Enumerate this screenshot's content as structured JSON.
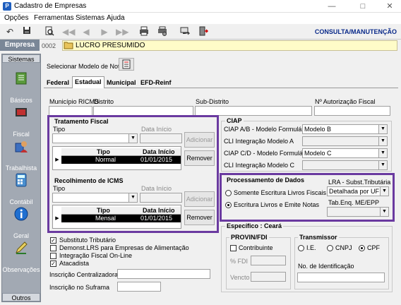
{
  "window": {
    "title": "Cadastro de Empresas",
    "app_icon": "P"
  },
  "menu": [
    "Opções",
    "Ferramentas",
    "Sistemas",
    "Ajuda"
  ],
  "toolbar": {
    "mode": "CONSULTA/MANUTENÇÃO"
  },
  "empresa": {
    "label": "Empresa",
    "code": "0002",
    "name": "LUCRO PRESUMIDO"
  },
  "sidebar": {
    "header": "Sistemas",
    "footer": "Outros",
    "items": [
      "Básicos",
      "Fiscal",
      "Trabalhista",
      "Contábil",
      "Geral",
      "Observações"
    ]
  },
  "select_model": {
    "label": "Selecionar Modelo de Nota"
  },
  "tabs": [
    "Federal",
    "Estadual",
    "Municipal",
    "EFD-Reinf"
  ],
  "municipio": {
    "ricms_label": "Município RICMS",
    "distrito_label": "Distrito",
    "subdistrito_label": "Sub-Distrito",
    "autorizacao_label": "Nº Autorização Fiscal"
  },
  "tratamento": {
    "title": "Tratamento Fiscal",
    "tipo_label": "Tipo",
    "data_label": "Data Início",
    "add_button": "Adicionar",
    "remove_button": "Remover",
    "grid_headers": [
      "Tipo",
      "Data Início"
    ],
    "row": {
      "tipo": "Normal",
      "data": "01/01/2015"
    }
  },
  "recolhimento": {
    "title": "Recolhimento de ICMS",
    "tipo_label": "Tipo",
    "data_label": "Data Início",
    "add_button": "Adicionar",
    "remove_button": "Remover",
    "grid_headers": [
      "Tipo",
      "Data Início"
    ],
    "row": {
      "tipo": "Mensal",
      "data": "01/01/2015"
    }
  },
  "ciap": {
    "title": "CIAP",
    "rows": [
      {
        "label": "CIAP  A/B - Modelo Formulário",
        "value": "Modelo B",
        "enabled": true
      },
      {
        "label": "CLI Integração Modelo A",
        "value": "",
        "enabled": false
      },
      {
        "label": "CIAP C/D - Modelo Formulário",
        "value": "Modelo C",
        "enabled": true
      },
      {
        "label": "CLI Integração Modelo C",
        "value": "",
        "enabled": false
      }
    ]
  },
  "processamento": {
    "title": "Processamento de Dados",
    "options": [
      "Somente Escritura Livros Fiscais",
      "Escritura Livros e Emite Notas"
    ],
    "selected": 1,
    "lra_label": "LRA - Subst.Tributária",
    "lra_value": "Detalhada por UF",
    "tabenq_label": "Tab.Enq. ME/EPP"
  },
  "checks": [
    {
      "label": "Substituto Tributário",
      "checked": true
    },
    {
      "label": "Demonst.LRS para Empresas de Alimentação",
      "checked": false
    },
    {
      "label": "Integração Fiscal On-Line",
      "checked": false
    },
    {
      "label": "Atacadista",
      "checked": true
    }
  ],
  "inscricao": {
    "centralizadora_label": "Inscrição Centralizadora",
    "suframa_label": "Inscrição no Suframa"
  },
  "especifico": {
    "title": "Específico : Ceará",
    "provin_title": "PROVIN/FDI",
    "contribuinte_label": "Contribuinte",
    "fdi_label": "% FDI",
    "vencto_label": "Vencto",
    "transmissor_title": "Transmissor",
    "trans_options": [
      "I.E.",
      "CNPJ",
      "CPF"
    ],
    "trans_selected": 2,
    "identificacao_label": "No. de Identificação"
  }
}
